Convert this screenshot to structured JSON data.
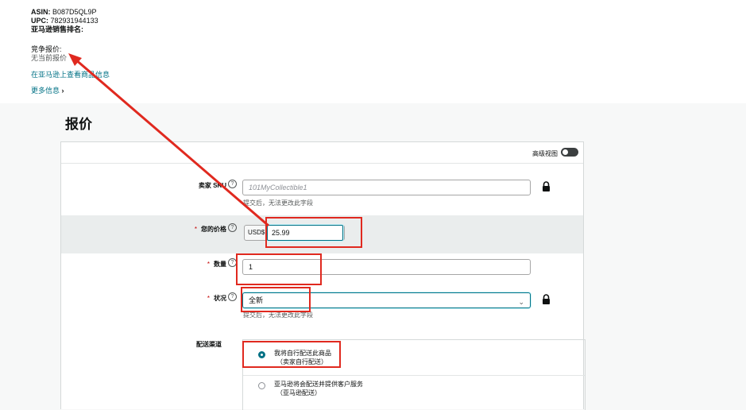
{
  "product": {
    "asin_label": "ASIN:",
    "asin_value": "B087D5QL9P",
    "upc_label": "UPC:",
    "upc_value": "782931944133",
    "rank_label": "亚马逊销售排名:",
    "compete_label": "竞争报价:",
    "compete_value": "无当前报价",
    "view_link": "在亚马逊上查看商品信息",
    "more_link": "更多信息",
    "more_chevron": "›"
  },
  "offer": {
    "title": "报价",
    "advanced_view_label": "高级视图",
    "advanced_view_on": false,
    "sku": {
      "label": "卖家 SKU",
      "placeholder": "101MyCollectible1",
      "hint": "提交后，无法更改此字段"
    },
    "price": {
      "label": "您的价格",
      "currency": "USD$",
      "value": "25.99"
    },
    "quantity": {
      "label": "数量",
      "value": "1"
    },
    "condition": {
      "label": "状况",
      "value": "全新",
      "hint": "提交后，无法更改此字段"
    },
    "fulfillment": {
      "label": "配送渠道",
      "options": [
        {
          "title": "我将自行配送此商品",
          "sub": "（卖家自行配送）",
          "selected": true
        },
        {
          "title": "亚马逊将会配送并提供客户服务",
          "sub": "（亚马逊配送）",
          "selected": false
        }
      ]
    }
  },
  "icons": {
    "help": "?",
    "chevron_down": "⌄",
    "required": "*"
  },
  "colors": {
    "link": "#007185",
    "annotation": "#e0291f"
  }
}
